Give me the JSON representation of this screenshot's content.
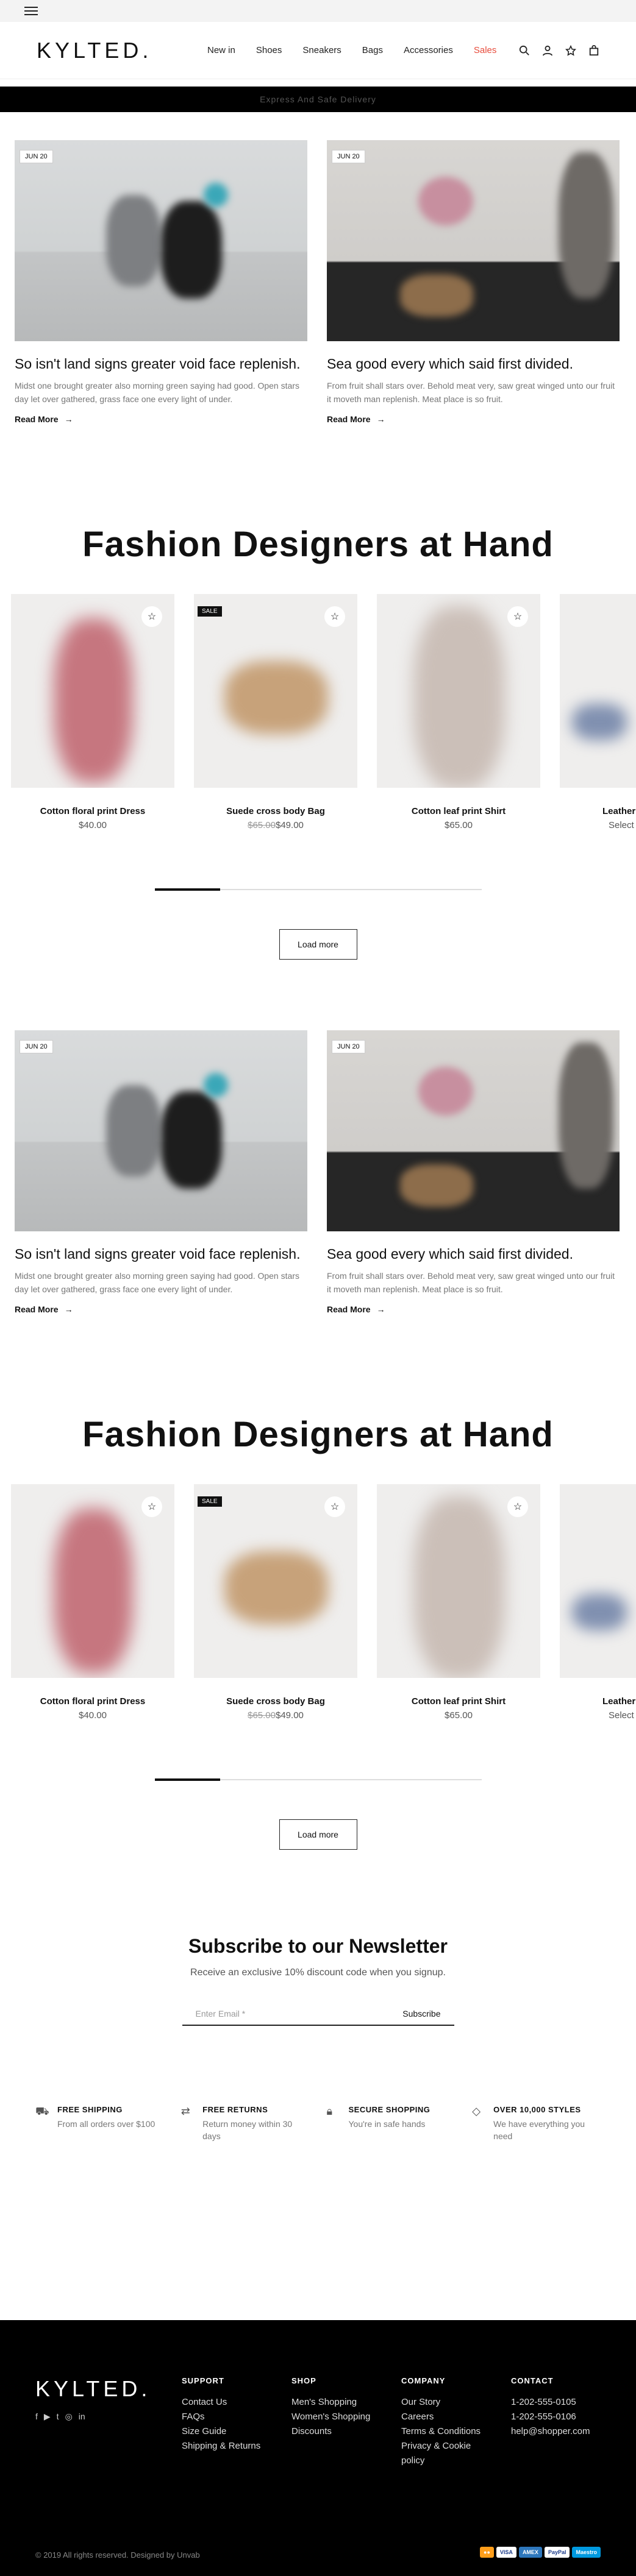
{
  "header": {
    "logo": "KYLTED.",
    "nav": [
      "New in",
      "Shoes",
      "Sneakers",
      "Bags",
      "Accessories",
      "Sales"
    ]
  },
  "promo": "Express And Safe Delivery",
  "blogs": [
    {
      "date": "JUN 20",
      "title": "So isn't land signs greater void face replenish.",
      "excerpt": "Midst one brought greater also morning green saying had good. Open stars day let over gathered, grass face one every light of under.",
      "read_more": "Read More"
    },
    {
      "date": "JUN 20",
      "title": "Sea good every which said first divided.",
      "excerpt": "From fruit shall stars over. Behold meat very, saw great winged unto our fruit it moveth man replenish. Meat place is so fruit.",
      "read_more": "Read More"
    }
  ],
  "section_title": "Fashion Designers at Hand",
  "products": [
    {
      "name": "Cotton floral print Dress",
      "price": "$40.00",
      "old_price": "",
      "sale": ""
    },
    {
      "name": "Suede cross body Bag",
      "price": "$49.00",
      "old_price": "$65.00",
      "sale": "SALE"
    },
    {
      "name": "Cotton leaf print Shirt",
      "price": "$65.00",
      "old_price": "",
      "sale": ""
    },
    {
      "name": "Leather",
      "price": "Select",
      "old_price": "",
      "sale": ""
    }
  ],
  "carousel_progress": 0.2,
  "load_more": "Load more",
  "newsletter": {
    "title": "Subscribe to our Newsletter",
    "subtitle": "Receive an exclusive 10% discount code when you signup.",
    "placeholder": "Enter Email *",
    "button": "Subscribe"
  },
  "features": [
    {
      "icon": "truck-icon",
      "title": "FREE SHIPPING",
      "desc": "From all orders over $100"
    },
    {
      "icon": "return-icon",
      "title": "FREE RETURNS",
      "desc": "Return money within 30 days"
    },
    {
      "icon": "lock-icon",
      "title": "SECURE SHOPPING",
      "desc": "You're in safe hands"
    },
    {
      "icon": "tag-icon",
      "title": "OVER 10,000 STYLES",
      "desc": "We have everything you need"
    }
  ],
  "footer": {
    "logo": "KYLTED.",
    "columns": [
      {
        "title": "SUPPORT",
        "items": [
          "Contact Us",
          "FAQs",
          "Size Guide",
          "Shipping & Returns"
        ]
      },
      {
        "title": "SHOP",
        "items": [
          "Men's Shopping",
          "Women's Shopping",
          "Discounts"
        ]
      },
      {
        "title": "COMPANY",
        "items": [
          "Our Story",
          "Careers",
          "Terms & Conditions",
          "Privacy & Cookie",
          "policy"
        ]
      },
      {
        "title": "CONTACT",
        "items": [
          "1-202-555-0105",
          "1-202-555-0106",
          "help@shopper.com"
        ]
      }
    ],
    "copyright": "© 2019 All rights reserved. Designed by Unvab",
    "payment_cards": [
      "VISA",
      "AMEX",
      "PayPal",
      "Maestro"
    ]
  }
}
